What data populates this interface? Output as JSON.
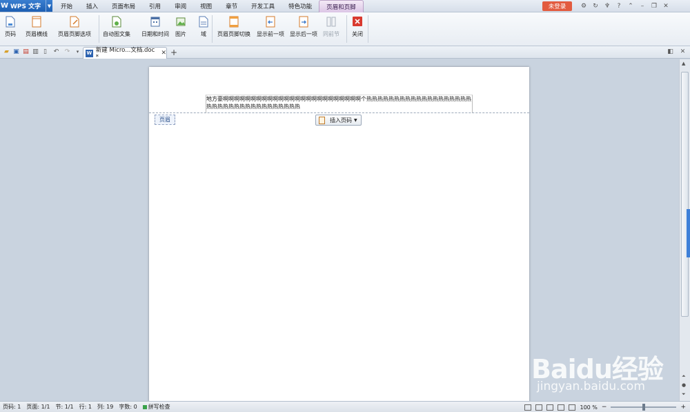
{
  "app": {
    "name": "WPS 文字",
    "logo": "W",
    "login_label": "未登录"
  },
  "menu": {
    "tabs": [
      "开始",
      "插入",
      "页面布局",
      "引用",
      "审阅",
      "视图",
      "章节",
      "开发工具",
      "特色功能",
      "页眉和页脚"
    ],
    "active_tab": "页眉和页脚"
  },
  "ribbon": {
    "page_number": "页码",
    "header_line": "页眉横线",
    "header_footer_options": "页眉页脚选项",
    "auto_text": "自动图文集",
    "date_time": "日期和时间",
    "picture": "图片",
    "field": "域",
    "switch_header_footer": "页眉页脚切换",
    "show_previous": "显示前一项",
    "show_next": "显示后一项",
    "same_as_previous": "同前节",
    "close": "关闭"
  },
  "document_tab": {
    "title": "新建 Micro...文档.doc *"
  },
  "document": {
    "header_text": "地方豪啊啊啊啊啊啊啊啊啊啊啊啊啊啊啊啊啊啊啊啊啊啊啊啊啊个热热热热热热热热热热热热热热热热热热热热热热热热热热热热热热热热热热热热",
    "header_label": "页眉",
    "insert_page_number_label": "插入页码"
  },
  "status": {
    "page_num": "页码: 1",
    "pages": "页面: 1/1",
    "section": "节: 1/1",
    "row": "行: 1",
    "column": "列: 19",
    "word_count": "字数: 0",
    "spell_check": "拼写检查",
    "zoom": "100 %"
  },
  "watermark": {
    "logo_text": "Baidu经验",
    "url": "jingyan.baidu.com"
  },
  "colors": {
    "login": "#e25b3f",
    "app_button": "#1d5fb3",
    "active_tab": "#dcc6e6"
  }
}
